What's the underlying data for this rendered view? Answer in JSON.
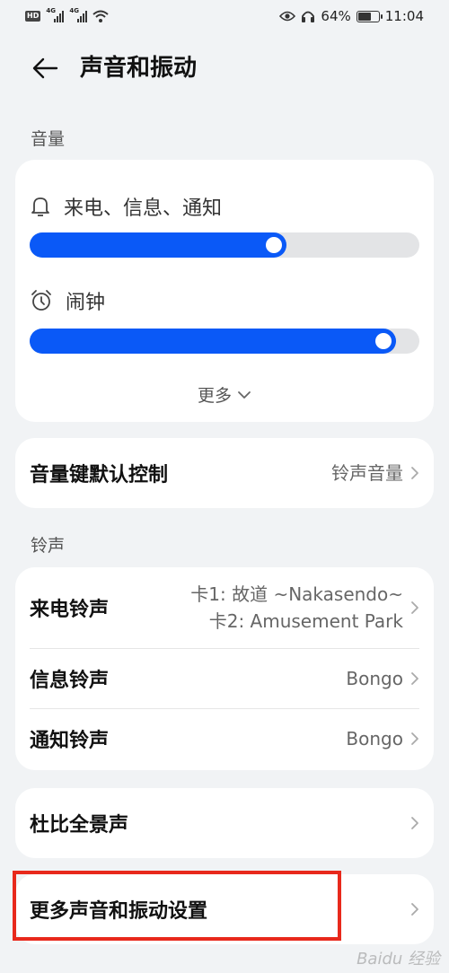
{
  "status_bar": {
    "hd_label": "HD",
    "sim1_network": "4G",
    "sim2_network": "4G",
    "battery_percent": "64%",
    "battery_level": 0.64,
    "time": "11:04"
  },
  "header": {
    "title": "声音和振动"
  },
  "volume_section": {
    "title": "音量",
    "ring": {
      "label": "来电、信息、通知",
      "level": 0.66
    },
    "alarm": {
      "label": "闹钟",
      "level": 0.94
    },
    "more_label": "更多"
  },
  "volume_key": {
    "label": "音量键默认控制",
    "value": "铃声音量"
  },
  "ringtone_section": {
    "title": "铃声",
    "items": [
      {
        "label": "来电铃声",
        "value_line1": "卡1: 故道 ~Nakasendo~",
        "value_line2": "卡2: Amusement Park"
      },
      {
        "label": "信息铃声",
        "value": "Bongo"
      },
      {
        "label": "通知铃声",
        "value": "Bongo"
      }
    ]
  },
  "dolby": {
    "label": "杜比全景声"
  },
  "more_settings": {
    "label": "更多声音和振动设置"
  },
  "colors": {
    "accent": "#0a59f7",
    "background": "#f1f3f5",
    "highlight_box": "#e8291c"
  },
  "watermark": "Baidu 经验"
}
